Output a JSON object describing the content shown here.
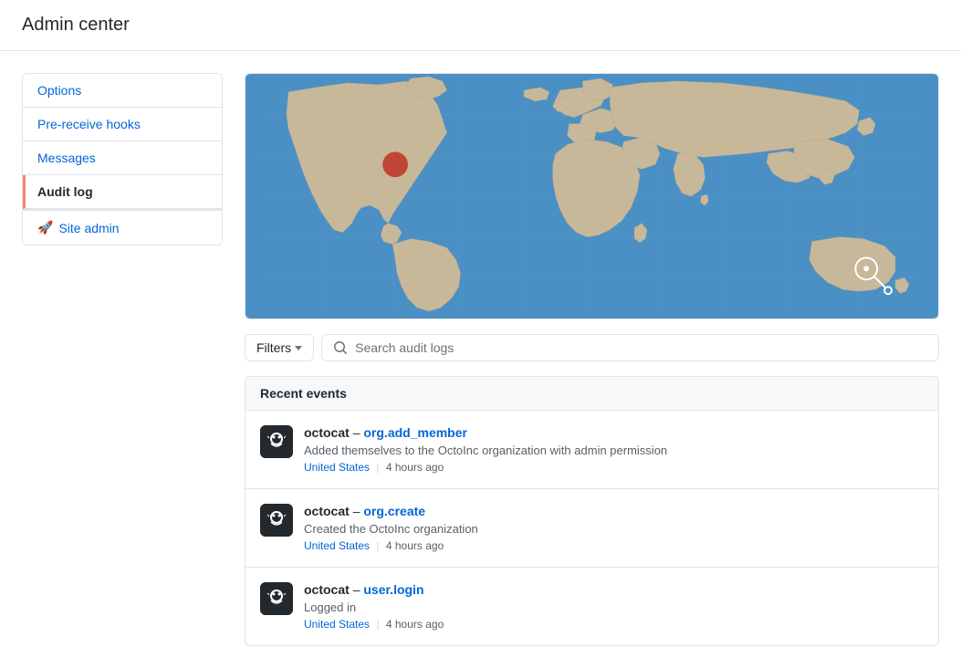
{
  "header": {
    "title": "Admin center"
  },
  "sidebar": {
    "items": [
      {
        "label": "Options",
        "active": false
      },
      {
        "label": "Pre-receive hooks",
        "active": false
      },
      {
        "label": "Messages",
        "active": false
      },
      {
        "label": "Audit log",
        "active": true
      }
    ],
    "site_admin": {
      "label": "Site admin",
      "icon": "🚀"
    }
  },
  "filters": {
    "button_label": "Filters",
    "search_placeholder": "Search audit logs"
  },
  "recent_events": {
    "header": "Recent events",
    "events": [
      {
        "username": "octocat",
        "action": "org.add_member",
        "description": "Added themselves to the OctoInc organization with admin permission",
        "location": "United States",
        "time": "4 hours ago"
      },
      {
        "username": "octocat",
        "action": "org.create",
        "description": "Created the OctoInc organization",
        "location": "United States",
        "time": "4 hours ago"
      },
      {
        "username": "octocat",
        "action": "user.login",
        "description": "Logged in",
        "location": "United States",
        "time": "4 hours ago"
      }
    ]
  },
  "colors": {
    "ocean": "#4a90c4",
    "land": "#c8b89a",
    "dot": "#c0392b",
    "active_border": "#f9826c"
  }
}
